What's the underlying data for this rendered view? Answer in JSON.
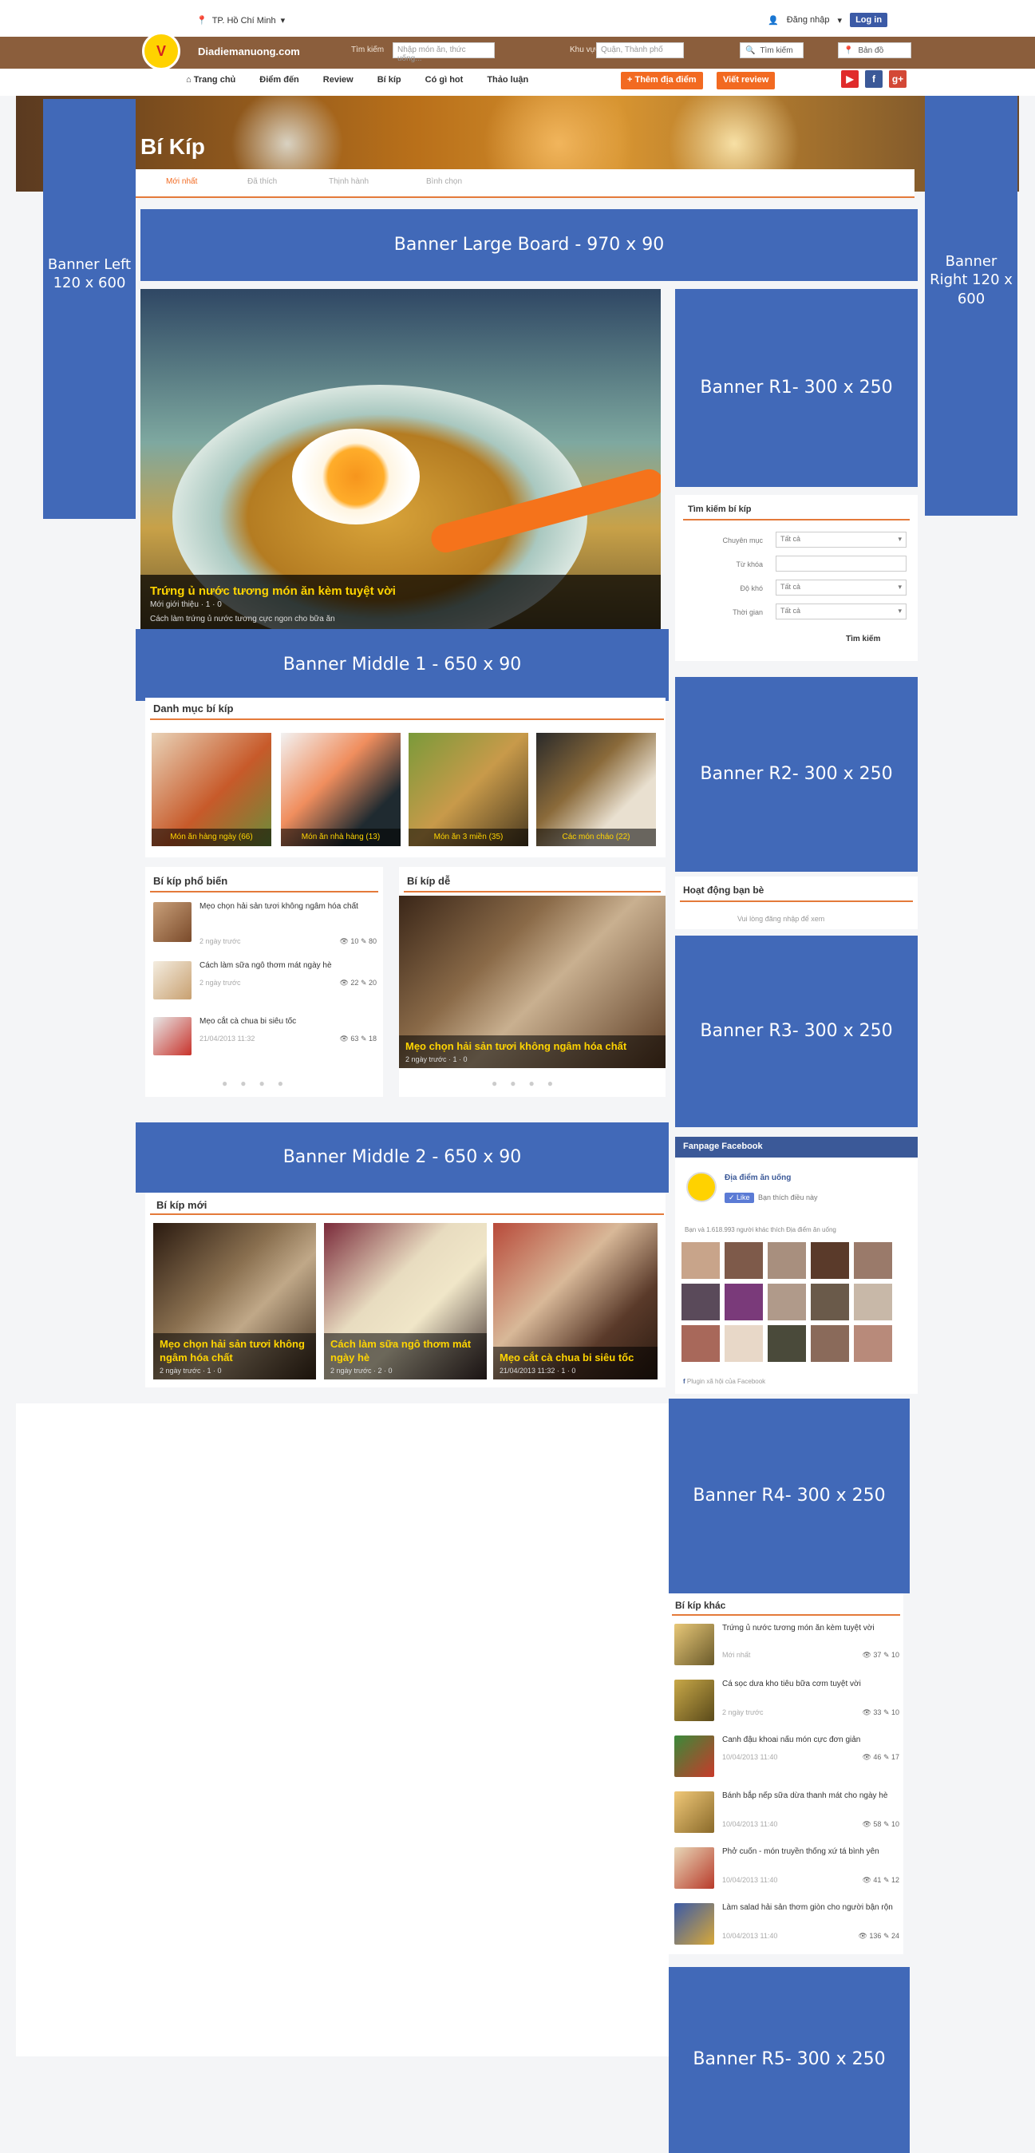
{
  "topbar": {
    "location": "TP. Hồ Chí Minh",
    "login": "Đăng nhập",
    "fb_login": "Log in"
  },
  "header": {
    "site_name": "Diadiemanuong.com",
    "logo_text": "V",
    "search_label1": "Tìm kiếm",
    "search_placeholder1": "Nhập món ăn, thức uống...",
    "search_label2": "Khu vực",
    "search_placeholder2": "Quận, Thành phố",
    "search_button": "Tìm kiếm",
    "map_button": "Bản đồ"
  },
  "nav": {
    "items": [
      "Trang chủ",
      "Điểm đến",
      "Review",
      "Bí kíp",
      "Có gì hot",
      "Thảo luận"
    ],
    "add_place": "+ Thêm địa điểm",
    "write_review": "Viết review"
  },
  "hero": {
    "title": "Bí Kíp",
    "tabs": [
      "Mới nhất",
      "Đã thích",
      "Thịnh hành",
      "Bình chọn"
    ]
  },
  "banners": {
    "left": "Banner Left 120 x 600",
    "right": "Banner Right 120 x 600",
    "large_board": "Banner Large Board - 970 x 90",
    "r1": "Banner R1- 300 x 250",
    "middle1": "Banner Middle 1 - 650 x 90",
    "r2": "Banner R2- 300 x 250",
    "r3": "Banner R3- 300 x 250",
    "middle2": "Banner Middle 2 - 650 x 90",
    "r4": "Banner R4- 300 x 250",
    "r5": "Banner R5- 300 x 250"
  },
  "featured": {
    "title": "Trứng ủ nước tương món ăn kèm tuyệt vời",
    "meta": "Mới giới thiệu · 1 · 0",
    "desc": "Cách làm trứng ủ nước tương cực ngon cho bữa ăn"
  },
  "search_box": {
    "title": "Tìm kiếm bí kíp",
    "fields": [
      {
        "label": "Chuyên mục",
        "value": "Tất cả"
      },
      {
        "label": "Từ khóa",
        "value": ""
      },
      {
        "label": "Độ khó",
        "value": "Tất cả"
      },
      {
        "label": "Thời gian",
        "value": "Tất cả"
      }
    ],
    "button": "Tìm kiếm"
  },
  "categories": {
    "title": "Danh mục bí kíp",
    "items": [
      "Món ăn hàng ngày (66)",
      "Món ăn nhà hàng (13)",
      "Món ăn 3 miền (35)",
      "Các món cháo (22)"
    ]
  },
  "popular": {
    "title": "Bí kíp phổ biến",
    "items": [
      {
        "title": "Mẹo chọn hải sản tươi không ngâm hóa chất",
        "date": "2 ngày trước",
        "views": "10",
        "comments": "80"
      },
      {
        "title": "Cách làm sữa ngô thơm mát ngày hè",
        "date": "2 ngày trước",
        "views": "22",
        "comments": "20"
      },
      {
        "title": "Mẹo cắt cà chua bi siêu tốc",
        "date": "21/04/2013 11:32",
        "views": "63",
        "comments": "18"
      }
    ]
  },
  "easy": {
    "title": "Bí kíp dễ",
    "card_title": "Mẹo chọn hải sản tươi không ngâm hóa chất",
    "card_meta": "2 ngày trước · 1 · 0"
  },
  "friends": {
    "title": "Hoạt động bạn bè",
    "text": "Vui lòng đăng nhập để xem"
  },
  "fanpage": {
    "title": "Fanpage Facebook",
    "page_name": "Địa điểm ăn uống",
    "like": "Like",
    "like_text": "Bạn thích điều này",
    "count_text": "Bạn và 1.618.993 người khác thích Địa điểm ăn uống",
    "plugin": "Plugin xã hội của Facebook"
  },
  "new": {
    "title": "Bí kíp mới",
    "items": [
      {
        "title": "Mẹo chọn hải sản tươi không ngâm hóa chất",
        "meta": "2 ngày trước · 1 · 0"
      },
      {
        "title": "Cách làm sữa ngô thơm mát ngày hè",
        "meta": "2 ngày trước · 2 · 0"
      },
      {
        "title": "Mẹo cắt cà chua bi siêu tốc",
        "meta": "21/04/2013 11:32 · 1 · 0"
      }
    ]
  },
  "other": {
    "title": "Bí kíp khác",
    "items": [
      {
        "title": "Trứng ủ nước tương món ăn kèm tuyệt vời",
        "date": "Mới nhất",
        "views": "37",
        "comments": "10"
      },
      {
        "title": "Cá sọc dưa kho tiêu bữa cơm tuyệt vời",
        "date": "2 ngày trước",
        "views": "33",
        "comments": "10"
      },
      {
        "title": "Canh đậu khoai nấu món cực đơn giản",
        "date": "10/04/2013 11:40",
        "views": "46",
        "comments": "17"
      },
      {
        "title": "Bánh bắp nếp sữa dừa thanh mát cho ngày hè",
        "date": "10/04/2013 11:40",
        "views": "58",
        "comments": "10"
      },
      {
        "title": "Phở cuốn - món truyền thống xứ tá bình yên",
        "date": "10/04/2013 11:40",
        "views": "41",
        "comments": "12"
      },
      {
        "title": "Làm salad hải sản thơm giòn cho người bận rộn",
        "date": "10/04/2013 11:40",
        "views": "136",
        "comments": "24"
      }
    ]
  },
  "colors": {
    "banner": "#4169b8",
    "accent": "#f26a21",
    "header_brown": "#8b5e3c",
    "highlight_text": "#ffd400"
  }
}
